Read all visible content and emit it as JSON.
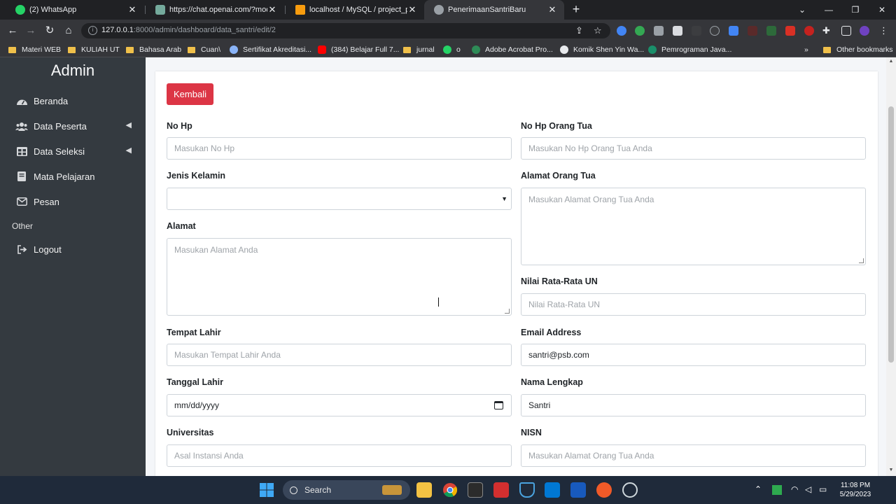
{
  "browser": {
    "tabs": [
      {
        "label": "(2) WhatsApp",
        "favicon_color": "#25d366",
        "active": false
      },
      {
        "label": "https://chat.openai.com/?model=",
        "favicon_color": "#74aa9c",
        "active": false
      },
      {
        "label": "localhost / MySQL / project_pene",
        "favicon_color": "#f89c0e",
        "active": false
      },
      {
        "label": "PenerimaanSantriBaru",
        "favicon_color": "#9aa0a6",
        "active": true
      }
    ],
    "url_host": "127.0.0.1",
    "url_rest": ":8000/admin/dashboard/data_santri/edit/2",
    "bookmarks": [
      {
        "label": "Materi WEB",
        "type": "folder"
      },
      {
        "label": "KULIAH UT",
        "type": "folder"
      },
      {
        "label": "Bahasa Arab",
        "type": "folder"
      },
      {
        "label": "Cuan\\",
        "type": "folder"
      },
      {
        "label": "Sertifikat Akreditasi...",
        "type": "site",
        "color": "#8ab4f8"
      },
      {
        "label": "(384) Belajar Full 7...",
        "type": "site",
        "color": "#ff0000"
      },
      {
        "label": "jurnal",
        "type": "folder"
      },
      {
        "label": "o",
        "type": "site",
        "color": "#25d366"
      },
      {
        "label": "Adobe Acrobat Pro...",
        "type": "site",
        "color": "#2e8b57"
      },
      {
        "label": "Komik Shen Yin Wa...",
        "type": "site",
        "color": "#e8eaed"
      },
      {
        "label": "Pemrograman Java...",
        "type": "site",
        "color": "#1a8f6a"
      },
      {
        "label": "Other bookmarks",
        "type": "folder"
      }
    ],
    "bookmarks_more": "»"
  },
  "sidebar": {
    "brand": "Admin",
    "items": [
      {
        "label": "Beranda",
        "icon": "gauge-icon"
      },
      {
        "label": "Data Peserta",
        "icon": "users-icon"
      },
      {
        "label": "Data Seleksi",
        "icon": "table-icon"
      },
      {
        "label": "Mata Pelajaran",
        "icon": "book-icon"
      },
      {
        "label": "Pesan",
        "icon": "envelope-icon"
      }
    ],
    "other_header": "Other",
    "logout_label": "Logout"
  },
  "form": {
    "back_button": "Kembali",
    "no_hp": {
      "label": "No Hp",
      "placeholder": "Masukan No Hp",
      "value": ""
    },
    "no_hp_ortu": {
      "label": "No Hp Orang Tua",
      "placeholder": "Masukan No Hp Orang Tua Anda",
      "value": ""
    },
    "jenis_kelamin": {
      "label": "Jenis Kelamin",
      "value": ""
    },
    "alamat_ortu": {
      "label": "Alamat Orang Tua",
      "placeholder": "Masukan Alamat Orang Tua Anda",
      "value": ""
    },
    "alamat": {
      "label": "Alamat",
      "placeholder": "Masukan Alamat Anda",
      "value": ""
    },
    "nilai_un": {
      "label": "Nilai Rata-Rata UN",
      "placeholder": "Nilai Rata-Rata UN",
      "value": ""
    },
    "tempat_lahir": {
      "label": "Tempat Lahir",
      "placeholder": "Masukan Tempat Lahir Anda",
      "value": ""
    },
    "email": {
      "label": "Email Address",
      "value": "santri@psb.com"
    },
    "tanggal_lahir": {
      "label": "Tanggal Lahir",
      "placeholder": "mm/dd/yyyy"
    },
    "nama_lengkap": {
      "label": "Nama Lengkap",
      "value": "Santri"
    },
    "universitas": {
      "label": "Universitas",
      "placeholder": "Asal Instansi Anda",
      "value": ""
    },
    "nisn": {
      "label": "NISN",
      "placeholder": "Masukan Alamat Orang Tua Anda",
      "value": ""
    }
  },
  "taskbar": {
    "search_label": "Search",
    "time": "11:08 PM",
    "date": "5/29/2023"
  }
}
